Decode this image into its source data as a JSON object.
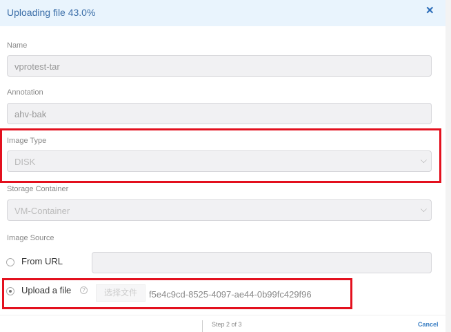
{
  "header": {
    "title": "Uploading file 43.0%",
    "close_icon": "close-icon"
  },
  "fields": {
    "name": {
      "label": "Name",
      "value": "vprotest-tar"
    },
    "annotation": {
      "label": "Annotation",
      "value": "ahv-bak"
    },
    "image_type": {
      "label": "Image Type",
      "value": "DISK"
    },
    "storage_container": {
      "label": "Storage Container",
      "value": "VM-Container"
    }
  },
  "image_source": {
    "label": "Image Source",
    "from_url": {
      "label": "From URL",
      "value": ""
    },
    "upload": {
      "label": "Upload a file",
      "help": "?",
      "button": "选择文件",
      "filename": "f5e4c9cd-8525-4097-ae44-0b99fc429f96"
    }
  },
  "footer": {
    "step": "Step 2 of 3",
    "cancel": "Cancel"
  }
}
